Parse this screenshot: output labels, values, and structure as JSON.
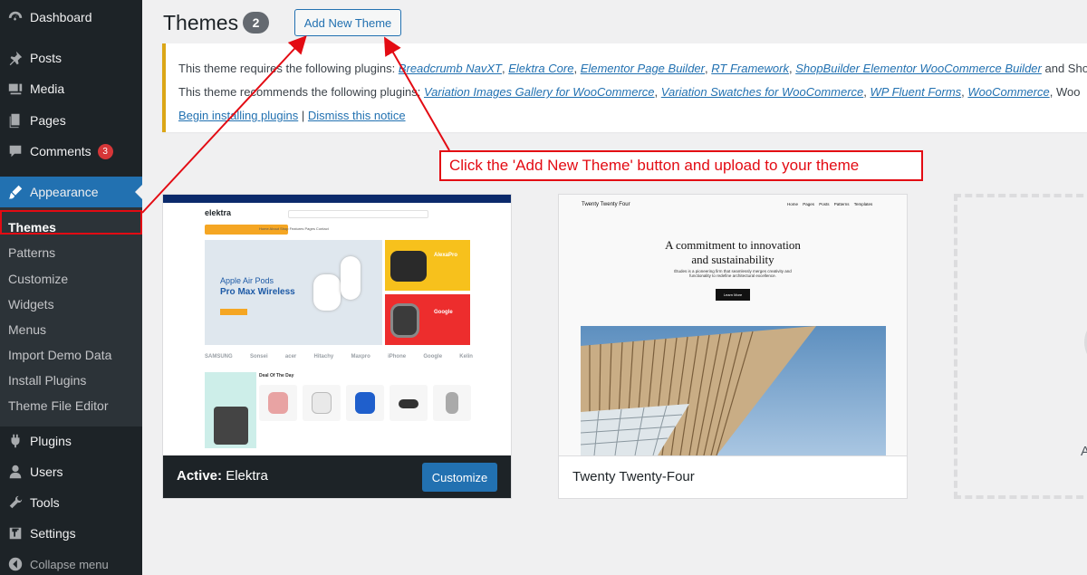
{
  "sidebar": {
    "items": [
      {
        "label": "Dashboard",
        "icon": "dashboard-icon"
      },
      {
        "label": "Posts",
        "icon": "pin-icon"
      },
      {
        "label": "Media",
        "icon": "media-icon"
      },
      {
        "label": "Pages",
        "icon": "pages-icon"
      },
      {
        "label": "Comments",
        "icon": "comments-icon",
        "badge": "3"
      },
      {
        "label": "Appearance",
        "icon": "appearance-icon"
      },
      {
        "label": "Plugins",
        "icon": "plugins-icon"
      },
      {
        "label": "Users",
        "icon": "users-icon"
      },
      {
        "label": "Tools",
        "icon": "tools-icon"
      },
      {
        "label": "Settings",
        "icon": "settings-icon"
      },
      {
        "label": "Collapse menu",
        "icon": "collapse-icon"
      }
    ],
    "submenu": [
      "Themes",
      "Patterns",
      "Customize",
      "Widgets",
      "Menus",
      "Import Demo Data",
      "Install Plugins",
      "Theme File Editor"
    ]
  },
  "header": {
    "title": "Themes",
    "count": "2",
    "add_new_label": "Add New Theme"
  },
  "notice": {
    "required_prefix": "This theme requires the following plugins:",
    "required": [
      "Breadcrumb NavXT",
      "Elektra Core",
      "Elementor Page Builder",
      "RT Framework",
      "ShopBuilder Elementor WooCommerce Builder"
    ],
    "required_suffix": "and Sho",
    "recommended_prefix": "This theme recommends the following plugins:",
    "recommended": [
      "Variation Images Gallery for WooCommerce",
      "Variation Swatches for WooCommerce",
      "WP Fluent Forms",
      "WooCommerce"
    ],
    "recommended_suffix": "Woo",
    "begin_installing": "Begin installing plugins",
    "separator": "|",
    "dismiss": "Dismiss this notice"
  },
  "callout": {
    "text": "Click the 'Add New Theme' button and upload to your theme",
    "color": "#e30b13"
  },
  "themes": [
    {
      "active_prefix": "Active:",
      "name": "Elektra",
      "action": "Customize",
      "preview": {
        "logo": "elektra",
        "nav": "Home   About   Shop   Features   Pages   Contact",
        "hero_line1": "Apple Air Pods",
        "hero_line2": "Pro Max Wireless",
        "promo1": "AlexaPro",
        "promo2": "Google",
        "brands": [
          "SAMSUNG",
          "Sonsei",
          "acer",
          "Hitachy",
          "Maxpro",
          "iPhone",
          "Google",
          "Kelin"
        ],
        "deal_title": "Deal Of The Day"
      }
    },
    {
      "name": "Twenty Twenty-Four",
      "preview": {
        "brand": "Twenty Twenty Four",
        "nav": "Home Pages Posts Patterns Templates",
        "headline1": "A commitment to innovation",
        "headline2": "and sustainability",
        "subtext": "Études is a pioneering firm that seamlessly merges creativity and functionality to redefine architectural excellence.",
        "button": "Learn More"
      }
    }
  ],
  "add_new_card_label": "A"
}
